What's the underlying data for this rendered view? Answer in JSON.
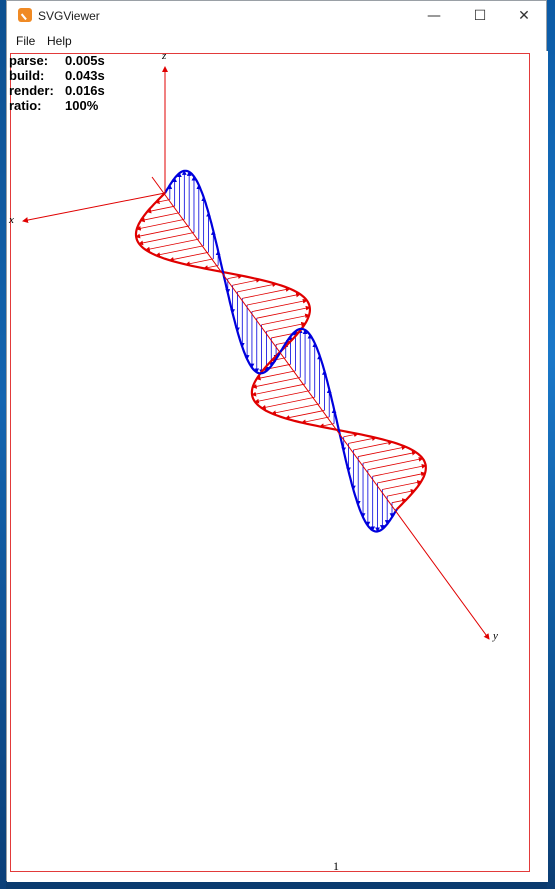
{
  "window": {
    "title": "SVGViewer",
    "minimize": "—",
    "maximize": "☐",
    "close": "✕"
  },
  "menu": {
    "file": "File",
    "help": "Help"
  },
  "stats": [
    {
      "label": "parse:",
      "value": "0.005s"
    },
    {
      "label": "build:",
      "value": "0.043s"
    },
    {
      "label": "render:",
      "value": "0.016s"
    },
    {
      "label": "ratio:",
      "value": "100%"
    }
  ],
  "axes": {
    "x": "x",
    "y": "y",
    "z": "z"
  },
  "page": {
    "number": "1"
  },
  "colors": {
    "electric": "#0000dd",
    "magnetic": "#e00000",
    "frame": "#e23a3a"
  },
  "icons": {
    "app": "svgviewer-app-icon"
  }
}
